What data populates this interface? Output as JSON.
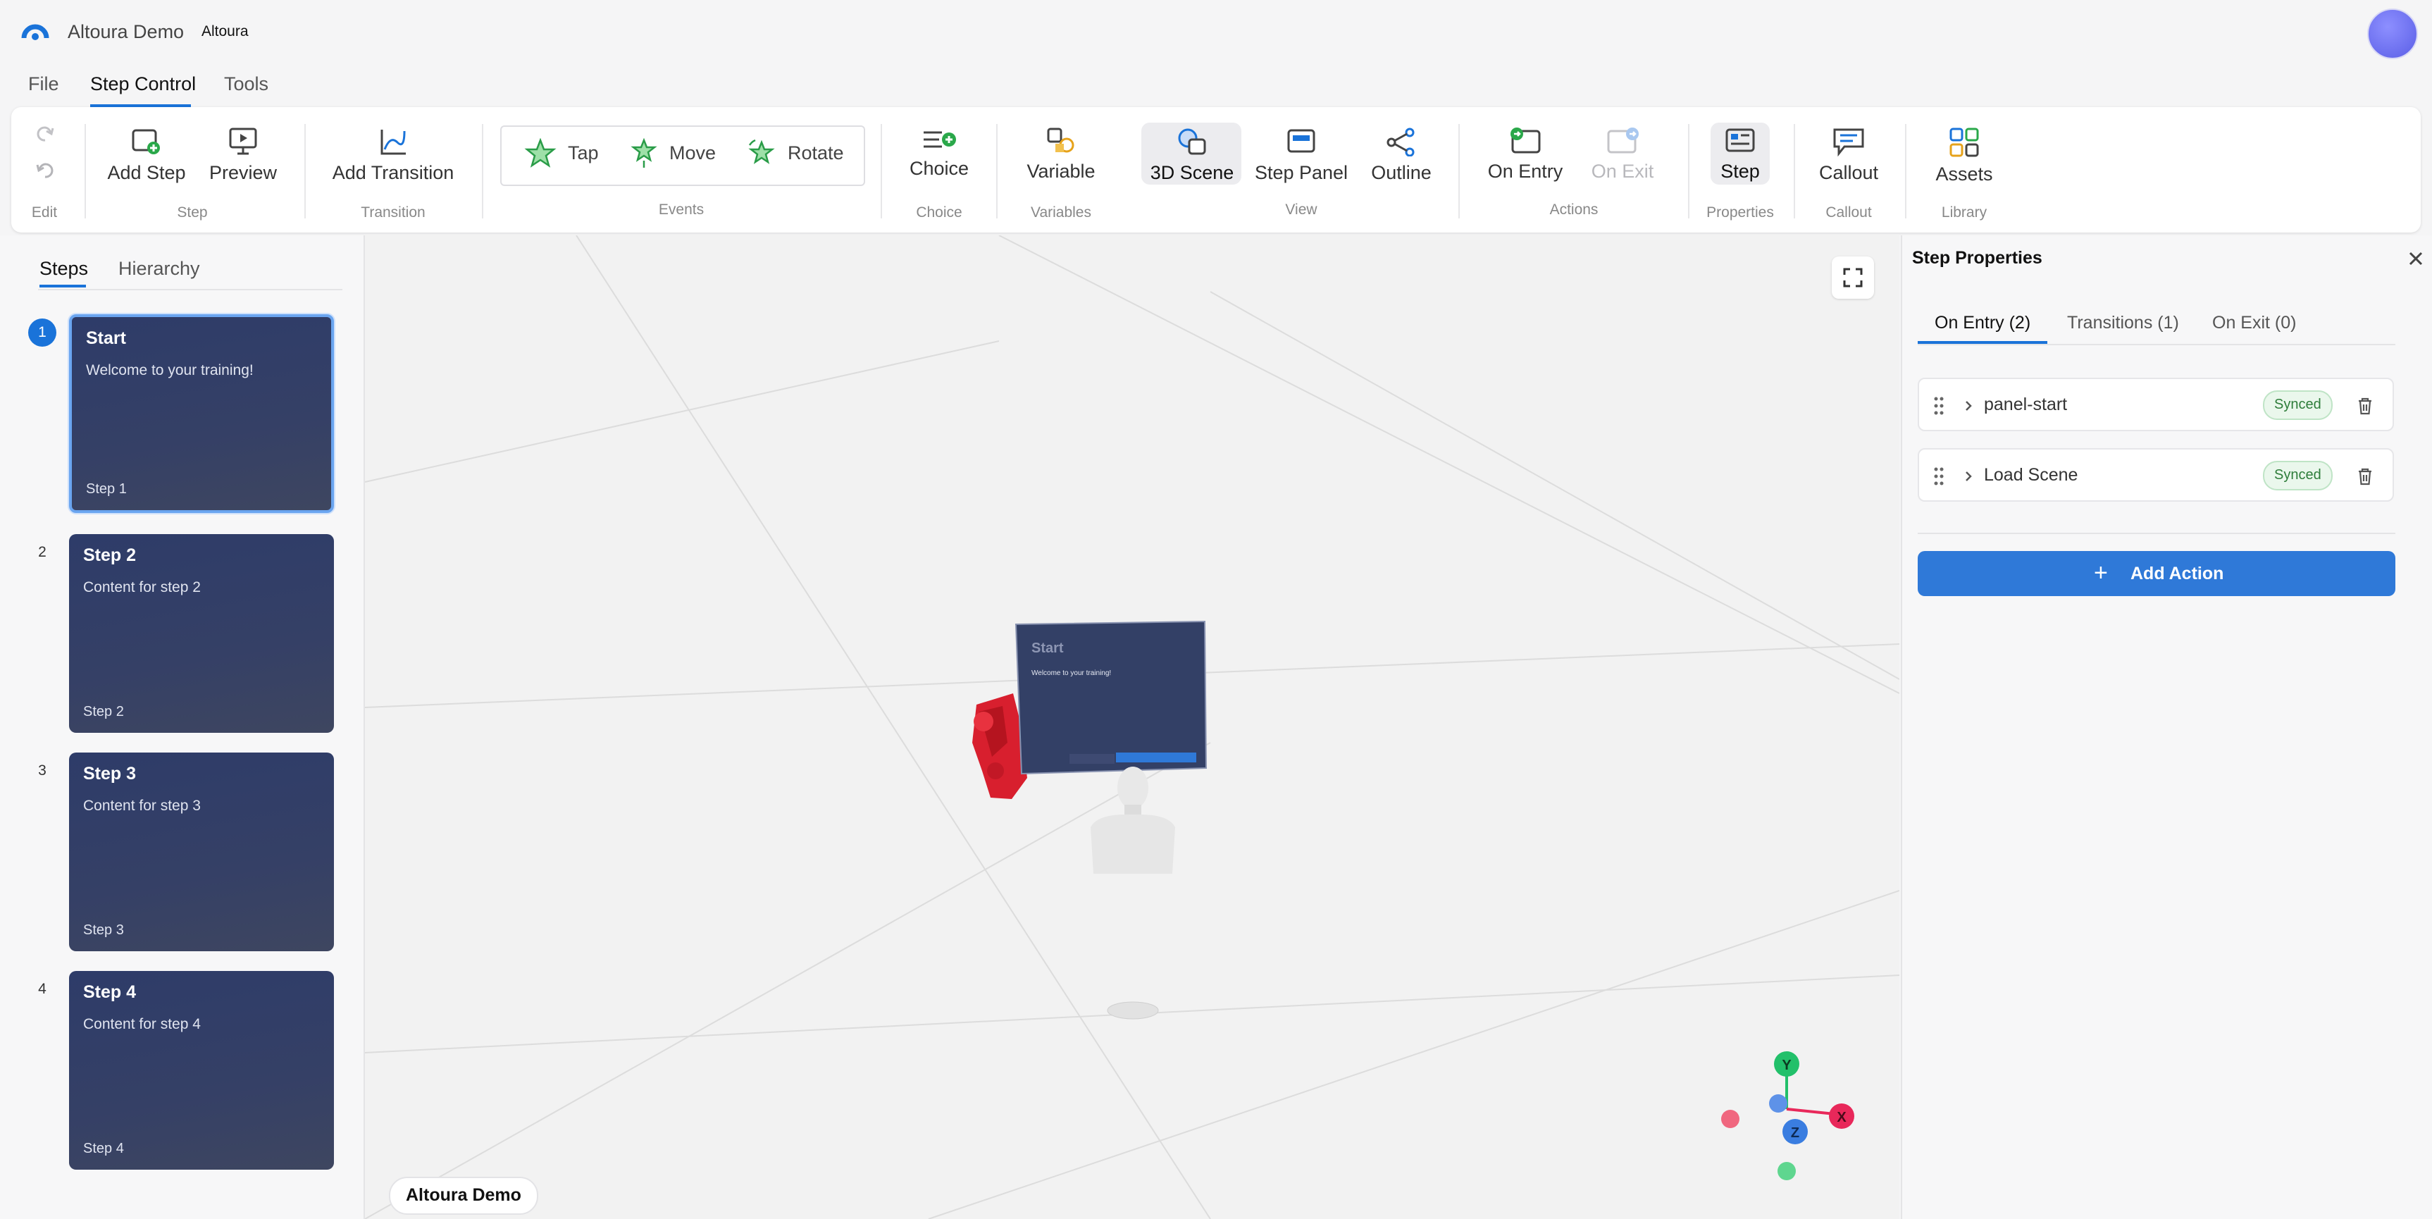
{
  "app": {
    "name": "Altoura Demo",
    "org": "Altoura"
  },
  "menu": {
    "file": "File",
    "step_control": "Step Control",
    "tools": "Tools"
  },
  "ribbon": {
    "groups": {
      "edit": "Edit",
      "step": "Step",
      "transition": "Transition",
      "events": "Events",
      "choice": "Choice",
      "variables": "Variables",
      "view": "View",
      "actions": "Actions",
      "properties": "Properties",
      "callout": "Callout",
      "library": "Library"
    },
    "buttons": {
      "add_step": "Add Step",
      "preview": "Preview",
      "add_transition": "Add Transition",
      "tap": "Tap",
      "move": "Move",
      "rotate": "Rotate",
      "choice": "Choice",
      "variable": "Variable",
      "scene_3d": "3D Scene",
      "step_panel": "Step Panel",
      "outline": "Outline",
      "on_entry": "On Entry",
      "on_exit": "On Exit",
      "step": "Step",
      "callout": "Callout",
      "assets": "Assets"
    },
    "active_view": "3D Scene",
    "disabled": [
      "On Exit",
      "redo",
      "undo"
    ]
  },
  "left_panel": {
    "tabs": {
      "steps": "Steps",
      "hierarchy": "Hierarchy"
    },
    "active_tab": "Steps",
    "steps": [
      {
        "num": "1",
        "title": "Start",
        "subtitle": "Welcome to your training!",
        "footer": "Step 1",
        "active": true
      },
      {
        "num": "2",
        "title": "Step 2",
        "subtitle": "Content for step 2",
        "footer": "Step 2",
        "active": false
      },
      {
        "num": "3",
        "title": "Step 3",
        "subtitle": "Content for step 3",
        "footer": "Step 3",
        "active": false
      },
      {
        "num": "4",
        "title": "Step 4",
        "subtitle": "Content for step 4",
        "footer": "Step 4",
        "active": false
      }
    ]
  },
  "viewport": {
    "scene_label": "Altoura Demo",
    "panel_title": "Start",
    "panel_text": "Welcome to your training!",
    "axes": {
      "x": "X",
      "y": "Y",
      "z": "Z"
    }
  },
  "right_panel": {
    "title": "Step Properties",
    "tabs": {
      "on_entry": "On Entry (2)",
      "transitions": "Transitions (1)",
      "on_exit": "On Exit (0)"
    },
    "active_tab": "On Entry (2)",
    "actions": [
      {
        "name": "panel-start",
        "status": "Synced"
      },
      {
        "name": "Load Scene",
        "status": "Synced"
      }
    ],
    "add_action_label": "Add Action"
  },
  "colors": {
    "accent": "#1a73d9",
    "button": "#2f79d8",
    "card": "#334066",
    "synced": "#2e7d3a",
    "axis_x": "#e8285a",
    "axis_y": "#22c06a",
    "axis_z": "#3a7de0"
  }
}
